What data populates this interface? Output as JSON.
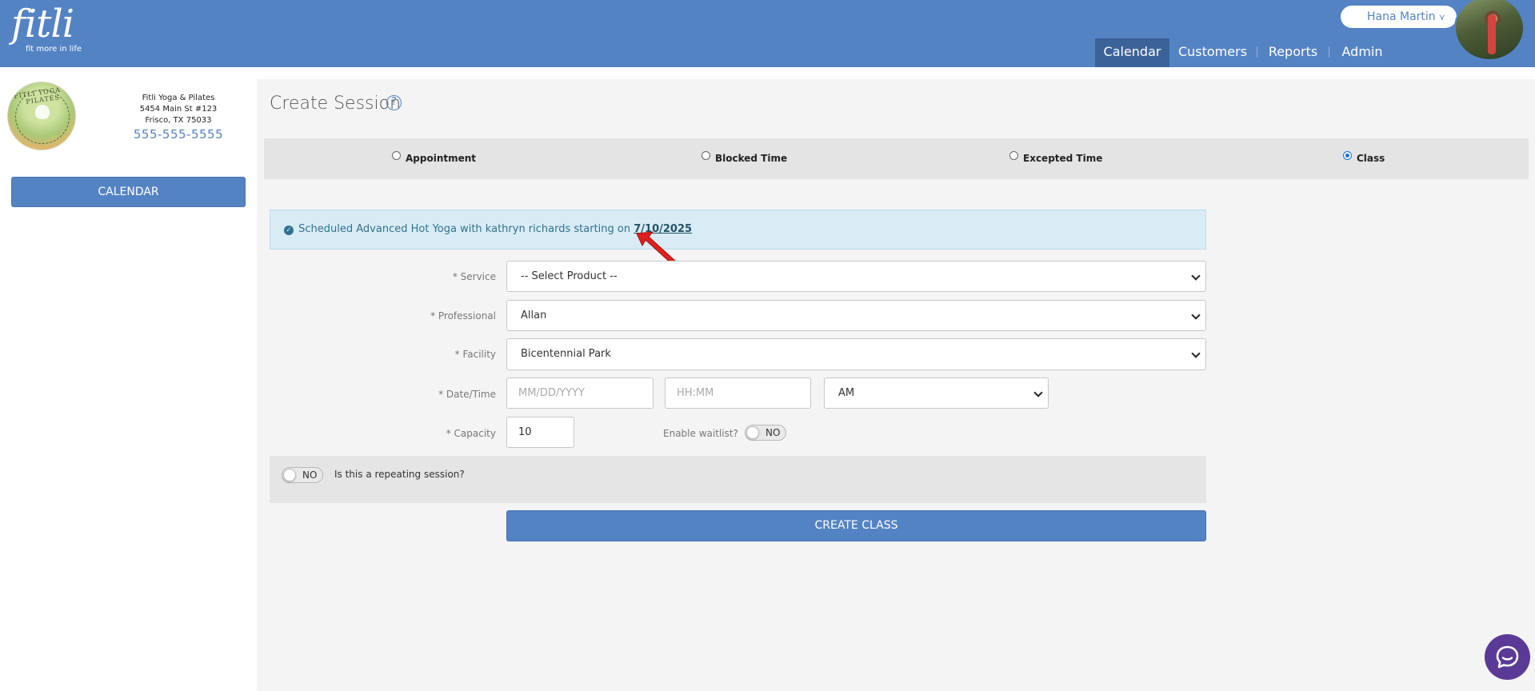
{
  "brand": {
    "logo_text": "fitli",
    "tagline": "fit more in life",
    "header_color": "#5483c4"
  },
  "user": {
    "name": "Hana Martin",
    "menu_icon": "double-chevron-down-icon"
  },
  "nav": {
    "items": [
      "Calendar",
      "Customers",
      "Reports",
      "Admin"
    ],
    "active": "Calendar"
  },
  "business": {
    "logo_text": "FITLI YOGA & PILATES",
    "name": "Fitli Yoga & Pilates",
    "address_line1": "5454 Main St #123",
    "address_line2": "Frisco, TX 75033",
    "phone": "555-555-5555"
  },
  "sidebar": {
    "calendar_button": "CALENDAR"
  },
  "page": {
    "title": "Create Session",
    "help_icon": "question-circle-icon"
  },
  "session_types": {
    "options": [
      "Appointment",
      "Blocked Time",
      "Excepted Time",
      "Class"
    ],
    "selected": "Class"
  },
  "alert": {
    "icon": "check-circle-icon",
    "message": "Scheduled Advanced Hot Yoga with kathryn richards starting on",
    "date_link": "7/10/2025"
  },
  "form": {
    "service": {
      "label": "* Service",
      "value": "-- Select Product --"
    },
    "professional": {
      "label": "* Professional",
      "value": "Allan"
    },
    "facility": {
      "label": "* Facility",
      "value": "Bicentennial Park"
    },
    "datetime": {
      "label": "* Date/Time",
      "date_placeholder": "MM/DD/YYYY",
      "time_placeholder": "HH:MM",
      "ampm_value": "AM"
    },
    "capacity": {
      "label": "* Capacity",
      "value": "10"
    },
    "waitlist": {
      "label": "Enable waitlist?",
      "toggle_label": "NO"
    },
    "repeating": {
      "toggle_label": "NO",
      "question": "Is this a repeating session?"
    },
    "submit_label": "CREATE CLASS"
  },
  "chat": {
    "icon": "chat-bubble-icon",
    "color": "#5a3a96"
  }
}
